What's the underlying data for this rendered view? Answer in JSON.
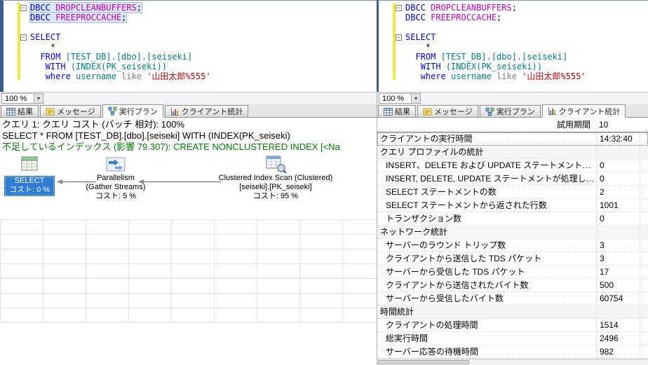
{
  "colors": {
    "keyword": "#0000ff",
    "dbcc_command": "#c800c8",
    "identifier": "#008080",
    "operator": "#6f7f8f",
    "string_literal": "#bb0000",
    "selection_bg": "#d9e6f4",
    "change_bar": "#f5e93e",
    "missing_index_green": "#008000",
    "select_node_blue": "#2f7cd6",
    "pane_edge_blue": "#3b5e94",
    "tab_active_bg": "#ffffff"
  },
  "zoom": {
    "value": "100 %"
  },
  "code": {
    "lines": [
      {
        "fold": true,
        "highlight": true,
        "tokens": [
          {
            "t": "DBCC ",
            "c": "kw"
          },
          {
            "t": "DROPCLEANBUFFERS",
            "c": "cmd"
          },
          {
            "t": ";",
            "c": "plain"
          }
        ]
      },
      {
        "highlight": true,
        "tokens": [
          {
            "t": "DBCC ",
            "c": "kw"
          },
          {
            "t": "FREEPROCCACHE",
            "c": "cmd"
          },
          {
            "t": ";",
            "c": "plain"
          }
        ]
      },
      {
        "tokens": []
      },
      {
        "fold": true,
        "tokens": [
          {
            "t": "SELECT",
            "c": "kw"
          }
        ]
      },
      {
        "tokens": [
          {
            "t": "    *",
            "c": "plain"
          }
        ]
      },
      {
        "tokens": [
          {
            "t": "  ",
            "c": "plain"
          },
          {
            "t": "FROM ",
            "c": "kw"
          },
          {
            "t": "[TEST_DB].[dbo].[seiseki]",
            "c": "id"
          }
        ]
      },
      {
        "tokens": [
          {
            "t": "   ",
            "c": "plain"
          },
          {
            "t": "WITH ",
            "c": "kw"
          },
          {
            "t": "(INDEX(PK_seiseki))",
            "c": "id"
          }
        ]
      },
      {
        "tokens": [
          {
            "t": "   ",
            "c": "plain"
          },
          {
            "t": "where ",
            "c": "kw"
          },
          {
            "t": "username ",
            "c": "id"
          },
          {
            "t": "like ",
            "c": "op"
          },
          {
            "t": "'山田太郎%555'",
            "c": "str"
          }
        ]
      }
    ]
  },
  "tabs": [
    {
      "label": "結果",
      "icon": "results-grid-icon"
    },
    {
      "label": "メッセージ",
      "icon": "messages-icon"
    },
    {
      "label": "実行プラン",
      "icon": "execution-plan-icon"
    },
    {
      "label": "クライアント統計",
      "icon": "client-statistics-icon"
    }
  ],
  "plan": {
    "query_header": "クエリ 1:  クエリ コスト  (バッチ 相対): 100%",
    "statement": "SELECT * FROM [TEST_DB].[dbo].[seiseki] WITH (INDEX(PK_seiseki)",
    "missing_index": "不足しているインデックス  (影響 79.307): CREATE NONCLUSTERED INDEX [<Na",
    "nodes": {
      "select": {
        "title": "SELECT",
        "cost": "コスト: 0 %"
      },
      "parallelism": {
        "line1": "Parallelism",
        "line2": "(Gather Streams)",
        "line3": "コスト: 5 %"
      },
      "scan": {
        "line1": "Clustered Index Scan (Clustered)",
        "line2": "[seiseki].[PK_seiseki]",
        "line3": "コスト: 95 %"
      }
    }
  },
  "stats": {
    "trial_header": {
      "label": "試用期間",
      "value": "10"
    },
    "rows": [
      {
        "label": "クライアントの実行時間",
        "value": "14:32:40",
        "indent": false,
        "focused": true
      },
      {
        "label": "クエリ プロファイルの統計",
        "type": "section"
      },
      {
        "label": "INSERT、DELETE および UPDATE ステートメントの数",
        "value": "0",
        "indent": true
      },
      {
        "label": "INSERT, DELETE, UPDATE ステートメントが処理した行...",
        "value": "0",
        "indent": true
      },
      {
        "label": "SELECT ステートメントの数",
        "value": "2",
        "indent": true
      },
      {
        "label": "SELECT ステートメントから返された行数",
        "value": "1001",
        "indent": true
      },
      {
        "label": "トランザクション数",
        "value": "0",
        "indent": true
      },
      {
        "label": "ネットワーク統計",
        "type": "section"
      },
      {
        "label": "サーバーのラウンド トリップ数",
        "value": "3",
        "indent": true
      },
      {
        "label": "クライアントから送信した TDS パケット",
        "value": "3",
        "indent": true
      },
      {
        "label": "サーバーから受信した TDS パケット",
        "value": "17",
        "indent": true
      },
      {
        "label": "クライアントから送信されたバイト数",
        "value": "500",
        "indent": true
      },
      {
        "label": "サーバーから受信したバイト数",
        "value": "60754",
        "indent": true
      },
      {
        "label": "時間統計",
        "type": "section"
      },
      {
        "label": "クライアントの処理時間",
        "value": "1514",
        "indent": true
      },
      {
        "label": "総実行時間",
        "value": "2496",
        "indent": true
      },
      {
        "label": "サーバー応答の待機時間",
        "value": "982",
        "indent": true
      }
    ]
  },
  "icons": {
    "tab_icons": [
      "results-grid-icon",
      "messages-icon",
      "execution-plan-icon",
      "client-statistics-icon"
    ],
    "plan_icons": [
      "select-result-icon",
      "parallelism-icon",
      "clustered-index-scan-icon"
    ],
    "zoom_dropdown": "chevron-down-icon"
  }
}
